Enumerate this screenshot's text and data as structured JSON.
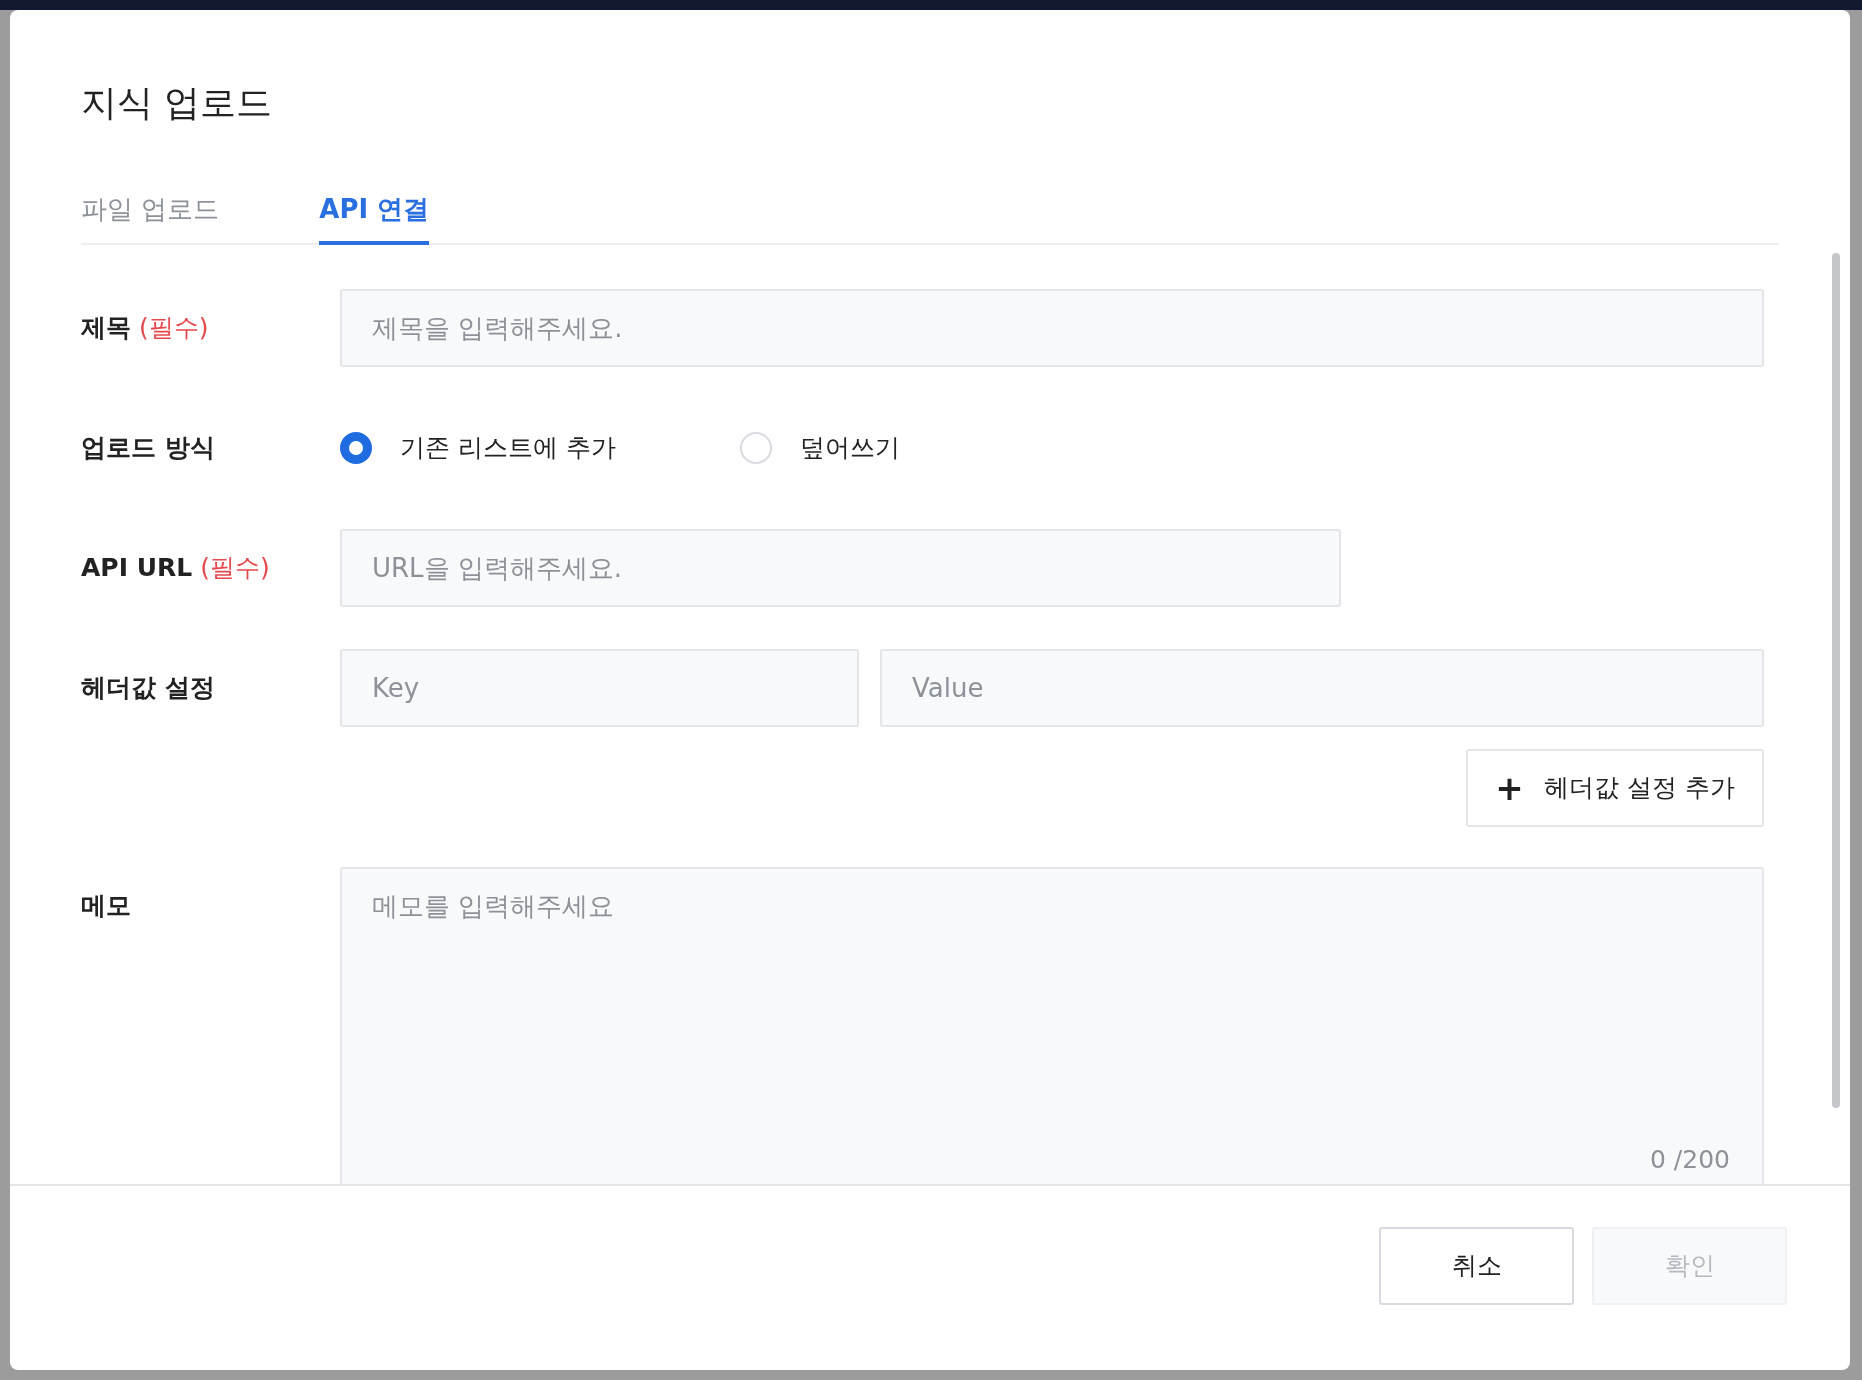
{
  "dialog": {
    "title": "지식 업로드"
  },
  "tabs": [
    {
      "label": "파일 업로드",
      "selected": false
    },
    {
      "label": "API 연결",
      "selected": true
    }
  ],
  "form": {
    "title_field": {
      "label": "제목",
      "required_mark": "(필수)",
      "placeholder": "제목을 입력해주세요."
    },
    "upload_mode": {
      "label": "업로드 방식",
      "options": [
        {
          "label": "기존 리스트에 추가",
          "selected": true
        },
        {
          "label": "덮어쓰기",
          "selected": false
        }
      ]
    },
    "api_url": {
      "label": "API URL",
      "required_mark": "(필수)",
      "placeholder": "URL을 입력해주세요."
    },
    "headers": {
      "label": "헤더값 설정",
      "key_placeholder": "Key",
      "value_placeholder": "Value",
      "add_button": {
        "icon": "+",
        "label": "헤더값 설정 추가"
      }
    },
    "memo": {
      "label": "메모",
      "placeholder": "메모를 입력해주세요",
      "counter": "0 /200"
    }
  },
  "buttons": [
    {
      "label": "취소",
      "disabled": false
    },
    {
      "label": "확인",
      "disabled": true
    }
  ]
}
